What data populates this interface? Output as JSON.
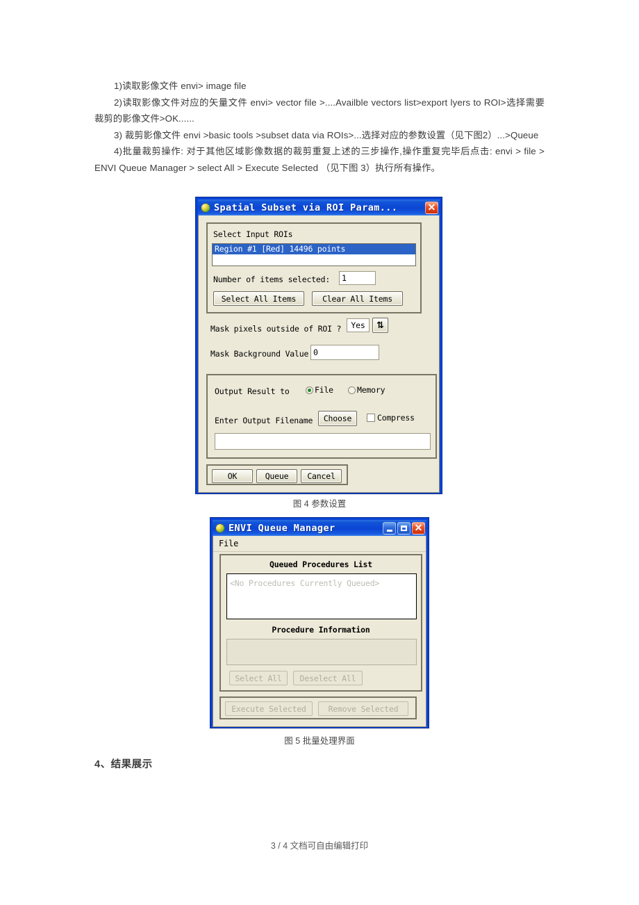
{
  "document": {
    "paragraphs": [
      "1)读取影像文件  envi> image file",
      "2)读取影像文件对应的矢量文件  envi> vector file >....Availble vectors list>export lyers to ROI>选择需要裁剪的影像文件>OK......",
      "3) 裁剪影像文件  envi >basic tools >subset data via ROIs>...选择对应的参数设置（见下图2）...>Queue",
      "4)批量裁剪操作: 对于其他区域影像数据的裁剪重复上述的三步操作,操作重复完毕后点击: envi > file > ENVI Queue Manager > select All > Execute Selected （见下图 3）执行所有操作。"
    ],
    "section_heading": "4、结果展示",
    "footer": "3 / 4 文档可自由编辑打印",
    "caption_fig4": "图 4 参数设置",
    "caption_fig5": "图 5 批量处理界面"
  },
  "subset_dialog": {
    "title": "Spatial Subset via ROI Param...",
    "app_icon": "envi-sphere-icon",
    "close_label": "✕",
    "roi_group": {
      "label": "Select Input ROIs",
      "items": [
        "Region #1 [Red] 14496 points"
      ],
      "num_selected_label": "Number of items selected:",
      "num_selected_value": "1",
      "select_all_label": "Select All Items",
      "clear_all_label": "Clear All Items"
    },
    "mask": {
      "pixels_label": "Mask pixels outside of ROI ?",
      "pixels_value": "Yes",
      "arrows_icon": "up-down-arrows-icon",
      "arrows_glyph": "⇅",
      "background_label": "Mask Background Value",
      "background_value": "0"
    },
    "output": {
      "result_to_label": "Output Result to",
      "option_file": "File",
      "option_memory": "Memory",
      "selected_option": "File",
      "filename_label": "Enter Output Filename",
      "choose_label": "Choose",
      "compress_label": "Compress",
      "compress_checked": false,
      "filename_value": ""
    },
    "actions": {
      "ok_label": "OK",
      "queue_label": "Queue",
      "cancel_label": "Cancel"
    },
    "colors": {
      "titlebar": "#0b45d4",
      "window_face": "#ece9d8",
      "selection": "#2b63c6",
      "close_button": "#cc2d0c",
      "radio_dot": "#1f8a2f"
    }
  },
  "queue_dialog": {
    "title": "ENVI Queue Manager",
    "app_icon": "envi-sphere-icon",
    "minimize_label": "_",
    "maximize_label": "□",
    "close_label": "✕",
    "menu": {
      "file": "File"
    },
    "queued_list_label": "Queued Procedures List",
    "queued_list_empty": "<No Procedures Currently Queued>",
    "procedure_information_label": "Procedure Information",
    "procedure_information_value": "",
    "select_all_label": "Select All",
    "deselect_all_label": "Deselect All",
    "execute_selected_label": "Execute Selected",
    "remove_selected_label": "Remove Selected",
    "disabled_buttons": [
      "Select All",
      "Deselect All",
      "Execute Selected",
      "Remove Selected"
    ]
  }
}
